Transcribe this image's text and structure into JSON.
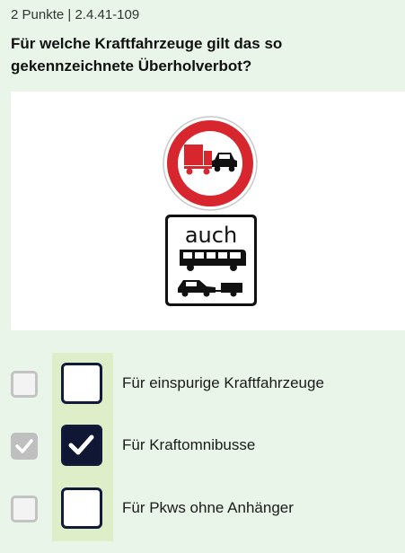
{
  "header": {
    "points": "2 Punkte",
    "separator": "|",
    "question_id": "2.4.41-109"
  },
  "question": {
    "text": "Für welche Kraftfahrzeuge gilt das so gekennzeichnete Überholverbot?"
  },
  "sign": {
    "supplementary_text": "auch"
  },
  "answers": [
    {
      "text": "Für einspurige Kraftfahrzeuge",
      "checked": false
    },
    {
      "text": "Für Kraftomnibusse",
      "checked": true
    },
    {
      "text": "Für Pkws ohne Anhänger",
      "checked": false
    }
  ],
  "colors": {
    "background": "#eaf5ea",
    "selection_column": "#ddeec8",
    "sign_red": "#d7262d",
    "checkbox_dark": "#101735"
  }
}
